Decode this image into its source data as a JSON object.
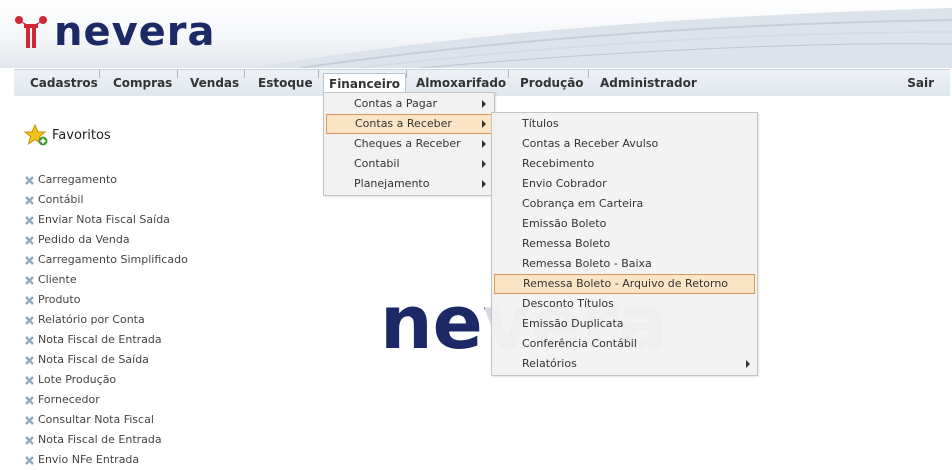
{
  "brand": {
    "name": "nevera",
    "watermark": "nevera"
  },
  "colors": {
    "brand_navy": "#1b2a66",
    "brand_red": "#d32637",
    "highlight": "#fbe5c4",
    "highlight_border": "#d59a5a"
  },
  "menubar": {
    "items": [
      "Cadastros",
      "Compras",
      "Vendas",
      "Estoque",
      "Financeiro",
      "Almoxarifado",
      "Produção",
      "Administrador"
    ],
    "active": "Financeiro",
    "logout_label": "Sair"
  },
  "financeiro_menu": {
    "items": [
      {
        "label": "Contas a Pagar",
        "has_submenu": true
      },
      {
        "label": "Contas a Receber",
        "has_submenu": true,
        "highlighted": true
      },
      {
        "label": "Cheques a Receber",
        "has_submenu": true
      },
      {
        "label": "Contabil",
        "has_submenu": true
      },
      {
        "label": "Planejamento",
        "has_submenu": true
      }
    ]
  },
  "contas_receber_menu": {
    "items": [
      {
        "label": "Títulos"
      },
      {
        "label": "Contas a Receber Avulso"
      },
      {
        "label": "Recebimento"
      },
      {
        "label": "Envio Cobrador"
      },
      {
        "label": "Cobrança em Carteira"
      },
      {
        "label": "Emissão Boleto"
      },
      {
        "label": "Remessa Boleto"
      },
      {
        "label": "Remessa Boleto - Baixa"
      },
      {
        "label": "Remessa Boleto - Arquivo de Retorno",
        "highlighted": true
      },
      {
        "label": "Desconto Títulos"
      },
      {
        "label": "Emissão Duplicata"
      },
      {
        "label": "Conferência Contábil"
      },
      {
        "label": "Relatórios",
        "has_submenu": true
      }
    ]
  },
  "favorites": {
    "title": "Favoritos",
    "title_icon": "star-add-icon",
    "item_icon": "remove-x-icon",
    "items": [
      "Carregamento",
      "Contábil",
      "Enviar Nota Fiscal Saída",
      "Pedido da Venda",
      "Carregamento Simplificado",
      "Cliente",
      "Produto",
      "Relatório por Conta",
      "Nota Fiscal de Entrada",
      "Nota Fiscal de Saída",
      "Lote Produção",
      "Fornecedor",
      "Consultar Nota Fiscal",
      "Nota Fiscal de Entrada",
      "Envio NFe Entrada"
    ]
  }
}
